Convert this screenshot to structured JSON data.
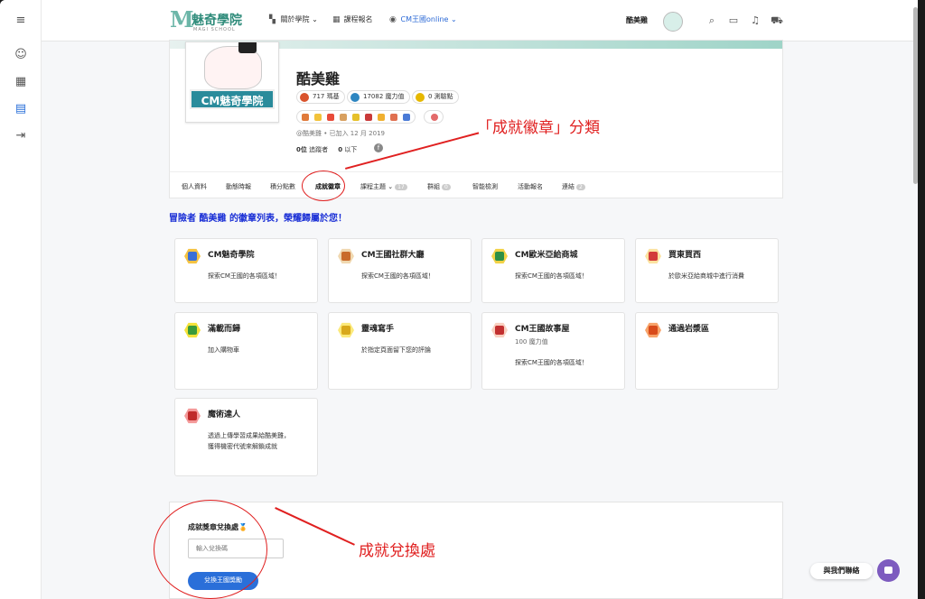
{
  "app": {
    "logo_mark": "M",
    "logo_text": "魅奇學院",
    "logo_sub": "MAGI SCHOOL"
  },
  "nav": {
    "about": "關於學院",
    "courses": "課程報名",
    "online": "CM王國online"
  },
  "user": {
    "name": "酷美雞"
  },
  "profile": {
    "avatar_banner": "CM魅奇學院",
    "name": "酷美雞",
    "stats": [
      {
        "value": "717 瑪基",
        "color": "#d9532c"
      },
      {
        "value": "17082 魔力值",
        "color": "#2e86c1"
      },
      {
        "value": "0 測驗點",
        "color": "#e6b800"
      }
    ],
    "meta": "@酷美雞 • 已加入 12 月 2019",
    "followers_count": "0位",
    "followers_label": "追蹤者",
    "following_count": "0",
    "following_label": "以下",
    "social_icon": "f"
  },
  "tabs": [
    {
      "label": "個人資料",
      "count": ""
    },
    {
      "label": "動態時報",
      "count": ""
    },
    {
      "label": "積分點數",
      "count": ""
    },
    {
      "label": "成就徽章",
      "count": ""
    },
    {
      "label": "課程主題",
      "count": "17"
    },
    {
      "label": "群組",
      "count": "0"
    },
    {
      "label": "智能檢測",
      "count": ""
    },
    {
      "label": "活動報名",
      "count": ""
    },
    {
      "label": "連結",
      "count": "2"
    }
  ],
  "annotations": {
    "category": "「成就徽章」分類",
    "redeem": "成就兌換處"
  },
  "section_title": "冒險者 酷美雞 的徽章列表，榮耀歸屬於您！",
  "badges": [
    {
      "title": "CM魅奇學院",
      "sub": "",
      "desc": "探索CM王國的各項區域！",
      "desc2": "",
      "color": "#3a6fd6",
      "bg": "#f5c342"
    },
    {
      "title": "CM王國社群大廳",
      "sub": "",
      "desc": "探索CM王國的各項區域！",
      "desc2": "",
      "color": "#c96b2a",
      "bg": "#f0d8b0"
    },
    {
      "title": "CM歐米亞給商城",
      "sub": "",
      "desc": "探索CM王國的各項區域！",
      "desc2": "",
      "color": "#2d8f45",
      "bg": "#f2d247"
    },
    {
      "title": "買東買西",
      "sub": "",
      "desc": "於歐米亞給商城中進行消費",
      "desc2": "",
      "color": "#d23a3a",
      "bg": "#fbe2a0"
    },
    {
      "title": "滿載而歸",
      "sub": "",
      "desc": "加入購物車",
      "desc2": "",
      "color": "#3a9a3a",
      "bg": "#f5e23a"
    },
    {
      "title": "靈魂寫手",
      "sub": "",
      "desc": "於指定頁面留下您的評論",
      "desc2": "",
      "color": "#d8a81a",
      "bg": "#fbe97a"
    },
    {
      "title": "CM王國故事屋",
      "sub": "100 魔力值",
      "desc": "探索CM王國的各項區域！",
      "desc2": "",
      "color": "#c23030",
      "bg": "#f9d0c0"
    },
    {
      "title": "通過岩漿區",
      "sub": "",
      "desc": "",
      "desc2": "",
      "color": "#d84a1a",
      "bg": "#f7a36a"
    },
    {
      "title": "魔術達人",
      "sub": "",
      "desc": "透過上傳學習成果給酷美雞，",
      "desc2": "獲得機密代號來解鎖成就",
      "color": "#c02a2a",
      "bg": "#f49a9a"
    }
  ],
  "redeem": {
    "title": "成就獎章兌換處",
    "medal": "🏅",
    "placeholder": "輸入兌換碼",
    "button": "兌換王國獎勵"
  },
  "contact": {
    "label": "與我們聯絡"
  },
  "icons": {
    "menu": "menu-icon",
    "search": "search-icon",
    "inbox": "inbox-icon",
    "bell": "bell-icon",
    "cart": "cart-icon"
  },
  "colors": {
    "accent": "#2a6fd9",
    "annotation": "#e02020",
    "section_title": "#1a2fd6"
  }
}
